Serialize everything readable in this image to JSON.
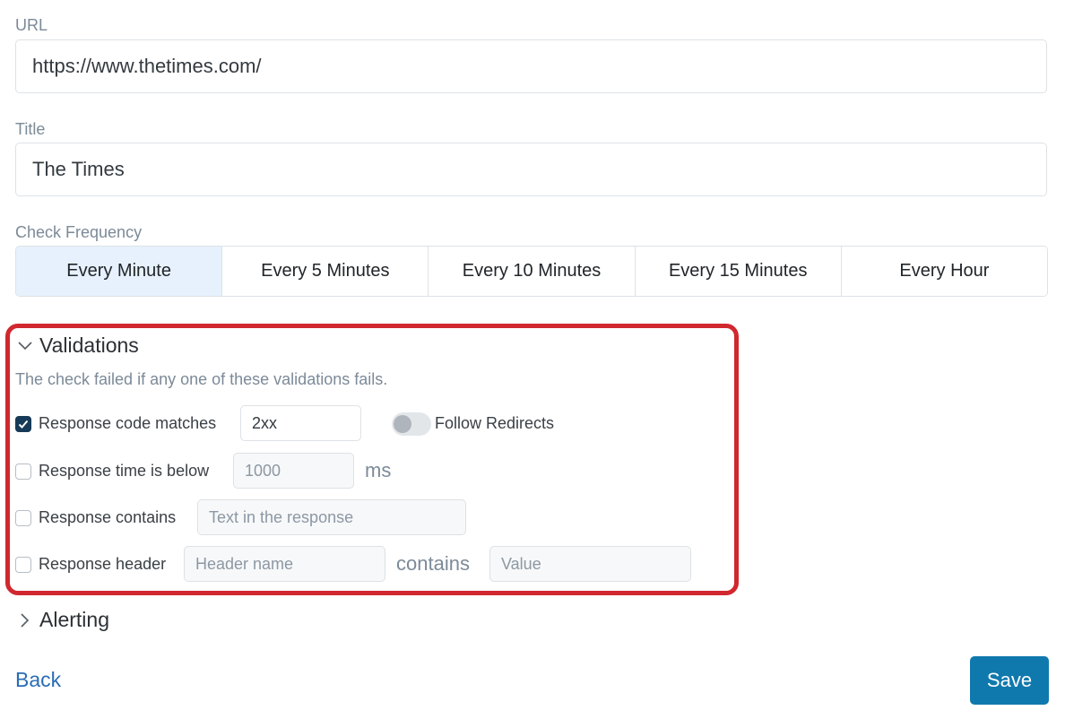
{
  "form": {
    "url_label": "URL",
    "url_value": "https://www.thetimes.com/",
    "title_label": "Title",
    "title_value": "The Times",
    "frequency_label": "Check Frequency",
    "frequency_options": [
      "Every Minute",
      "Every 5 Minutes",
      "Every 10 Minutes",
      "Every 15 Minutes",
      "Every Hour"
    ],
    "frequency_selected": "Every Minute"
  },
  "validations": {
    "header": "Validations",
    "description": "The check failed if any one of these validations fails.",
    "response_code": {
      "label": "Response code matches",
      "checked": true,
      "value": "2xx"
    },
    "follow_redirects": {
      "label": "Follow Redirects",
      "enabled": false
    },
    "response_time": {
      "label": "Response time is below",
      "checked": false,
      "placeholder": "1000",
      "unit": "ms"
    },
    "response_contains": {
      "label": "Response contains",
      "checked": false,
      "placeholder": "Text in the response"
    },
    "response_header": {
      "label": "Response header",
      "checked": false,
      "name_placeholder": "Header name",
      "connector": "contains",
      "value_placeholder": "Value"
    }
  },
  "alerting": {
    "header": "Alerting"
  },
  "footer": {
    "back_label": "Back",
    "save_label": "Save"
  },
  "colors": {
    "accent": "#0f79ad",
    "highlight_border": "#d0282e",
    "selected_bg": "#e6f1fd",
    "checkbox_checked": "#163a57"
  },
  "icons": {
    "expanded": "chevron-down-icon",
    "collapsed": "chevron-right-icon",
    "check": "checkmark-icon"
  }
}
